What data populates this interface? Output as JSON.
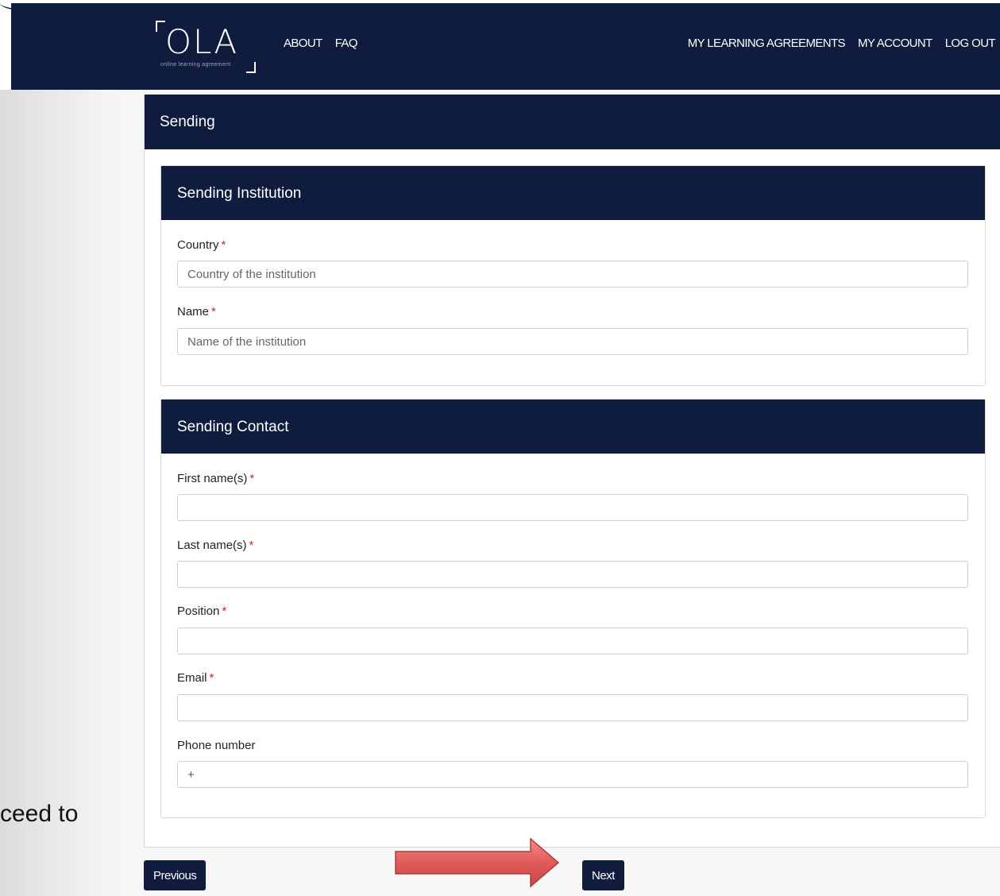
{
  "nav": {
    "left_links": [
      "ABOUT",
      "FAQ"
    ],
    "right_links": [
      "MY LEARNING AGREEMENTS",
      "MY ACCOUNT",
      "LOG OUT"
    ],
    "logo_text": "OLA",
    "logo_subtitle": "online learning agreement"
  },
  "page": {
    "section_title": "Sending"
  },
  "institution": {
    "title": "Sending Institution",
    "country_label": "Country",
    "country_placeholder": "Country of the institution",
    "name_label": "Name",
    "name_placeholder": "Name of the institution"
  },
  "contact": {
    "title": "Sending Contact",
    "first_name_label": "First name(s)",
    "last_name_label": "Last name(s)",
    "position_label": "Position",
    "email_label": "Email",
    "phone_label": "Phone number",
    "phone_value": "+"
  },
  "required_mark": "*",
  "buttons": {
    "previous": "Previous",
    "next": "Next"
  },
  "side_text": "ceed to",
  "colors": {
    "navy": "#0f1c3d",
    "required": "#dd2222",
    "arrow": "#e25b5b"
  }
}
